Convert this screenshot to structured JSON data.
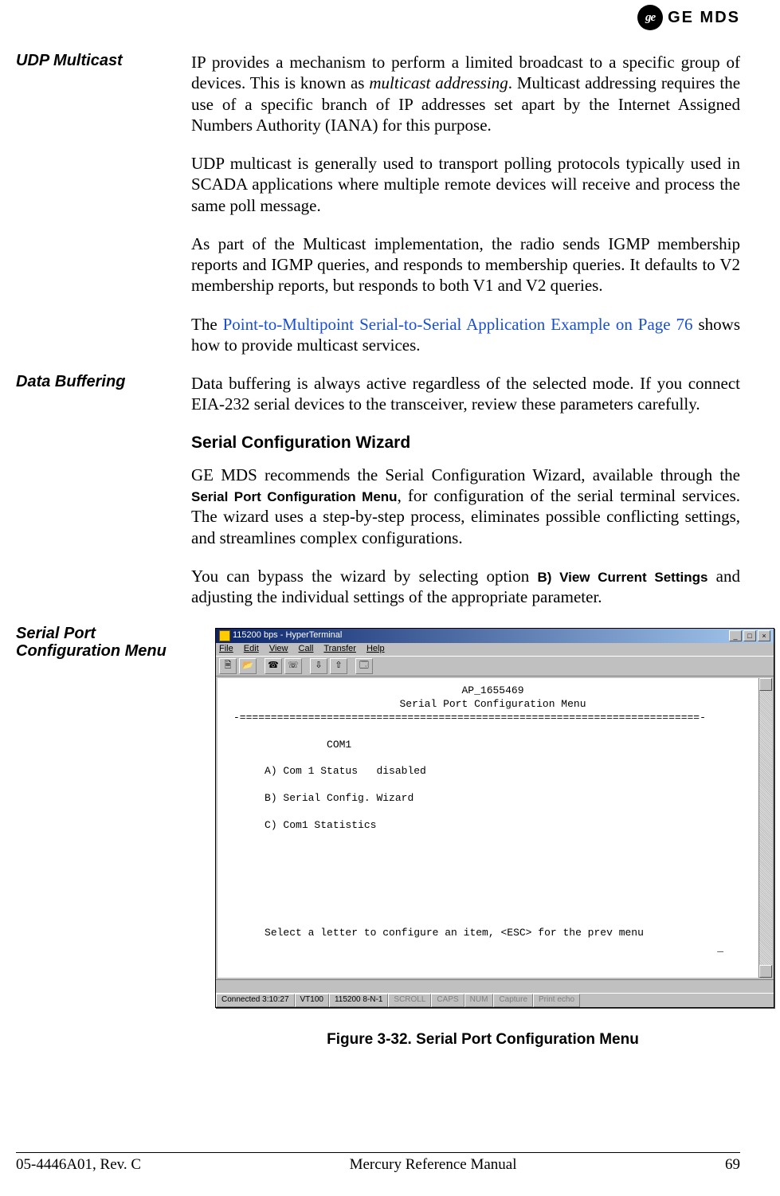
{
  "logo": {
    "monogram": "ge",
    "text": "GE MDS"
  },
  "sections": {
    "udp": {
      "heading": "UDP Multicast",
      "p1a": "IP provides a mechanism to perform a limited broadcast to a specific group of devices. This is known as ",
      "p1_em": "multicast addressing",
      "p1b": ". Multicast addressing requires the use of a specific branch of IP addresses set apart by the Internet Assigned Numbers Authority (IANA) for this purpose.",
      "p2": "UDP multicast is generally used to transport polling protocols typically used in SCADA applications where multiple remote devices will receive and process the same poll message.",
      "p3": "As part of the Multicast implementation, the radio sends IGMP membership reports and IGMP queries, and responds to membership queries. It defaults to V2 membership reports, but responds to both V1 and V2 queries.",
      "p4a": "The ",
      "p4_link": "Point-to-Multipoint Serial-to-Serial Application Example on Page 76",
      "p4b": " shows how to provide multicast services."
    },
    "buf": {
      "heading": "Data Buffering",
      "p1": "Data buffering is always active regardless of the selected mode. If you connect EIA-232 serial devices to the transceiver, review these parameters carefully."
    },
    "wizard": {
      "heading": "Serial Configuration Wizard",
      "p1a": "GE MDS recommends the Serial Configuration Wizard, available through the ",
      "p1_bold": "Serial Port Configuration Menu",
      "p1b": ", for configuration of the serial terminal services. The wizard uses a step-by-step process, eliminates possible conflicting settings, and streamlines complex configurations.",
      "p2a": "You can bypass the wizard by selecting option ",
      "p2_bold": "B) View Current Settings",
      "p2b": " and adjusting the individual settings of the appropriate parameter."
    },
    "fig": {
      "side_heading": "Serial Port Configuration Menu",
      "caption": "Figure 3-32. Serial Port Configuration Menu"
    }
  },
  "hyperterminal": {
    "title": "115200 bps - HyperTerminal",
    "menu": [
      "File",
      "Edit",
      "View",
      "Call",
      "Transfer",
      "Help"
    ],
    "term_id": "AP_1655469",
    "term_title": "Serial Port Configuration Menu",
    "sep": "-==========================================================================-",
    "col_head": "COM1",
    "optA": "A) Com 1 Status   disabled",
    "optB": "B) Serial Config. Wizard",
    "optC": "C) Com1 Statistics",
    "prompt": "Select a letter to configure an item, <ESC> for the prev menu",
    "cursor": "_",
    "status": {
      "conn": "Connected 3:10:27",
      "emul": "VT100",
      "rate": "115200 8-N-1",
      "scroll": "SCROLL",
      "caps": "CAPS",
      "num": "NUM",
      "capture": "Capture",
      "echo": "Print echo"
    }
  },
  "footer": {
    "left": "05-4446A01, Rev. C",
    "center": "Mercury Reference Manual",
    "right": "69"
  }
}
